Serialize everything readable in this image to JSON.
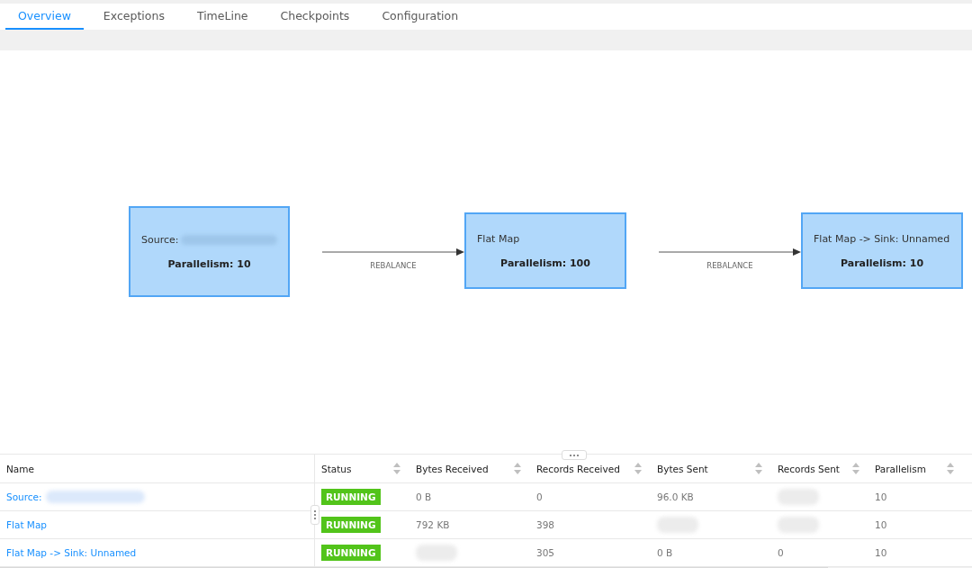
{
  "tabs": [
    {
      "label": "Overview",
      "selected": true
    },
    {
      "label": "Exceptions",
      "selected": false
    },
    {
      "label": "TimeLine",
      "selected": false
    },
    {
      "label": "Checkpoints",
      "selected": false
    },
    {
      "label": "Configuration",
      "selected": false
    }
  ],
  "graph": {
    "nodes": [
      {
        "label": "Source:",
        "blurred": true,
        "parallelism": "Parallelism: 10"
      },
      {
        "label": "Flat Map",
        "blurred": false,
        "parallelism": "Parallelism: 100"
      },
      {
        "label": "Flat Map -> Sink: Unnamed",
        "blurred": false,
        "parallelism": "Parallelism: 10"
      }
    ],
    "edges": [
      {
        "label": "REBALANCE"
      },
      {
        "label": "REBALANCE"
      }
    ]
  },
  "table": {
    "columns": [
      {
        "label": "Name",
        "sortable": false
      },
      {
        "label": "Status",
        "sortable": true
      },
      {
        "label": "Bytes Received",
        "sortable": true
      },
      {
        "label": "Records Received",
        "sortable": true
      },
      {
        "label": "Bytes Sent",
        "sortable": true
      },
      {
        "label": "Records Sent",
        "sortable": true
      },
      {
        "label": "Parallelism",
        "sortable": true
      }
    ],
    "rows": [
      {
        "name_blurred": true,
        "cells": [
          "Source:",
          "RUNNING",
          "0 B",
          "0",
          "96.0 KB",
          null,
          "10"
        ]
      },
      {
        "name_blurred": false,
        "cells": [
          "Flat Map",
          "RUNNING",
          "792 KB",
          "398",
          null,
          null,
          "10"
        ]
      },
      {
        "name_blurred": false,
        "cells": [
          "Flat Map -> Sink: Unnamed",
          "RUNNING",
          null,
          "305",
          "0 B",
          "0",
          "10"
        ]
      }
    ]
  }
}
